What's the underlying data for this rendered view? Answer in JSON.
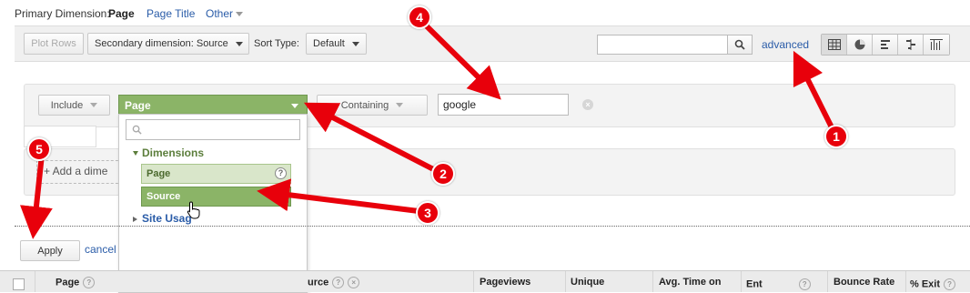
{
  "primary_dimension": {
    "label": "Primary Dimension:",
    "options": [
      {
        "label": "Page",
        "selected": true
      },
      {
        "label": "Page Title",
        "selected": false
      },
      {
        "label": "Other",
        "selected": false
      }
    ]
  },
  "toolbar": {
    "plot_rows": "Plot Rows",
    "secondary_dimension": "Secondary dimension: Source",
    "sort_type_label": "Sort Type:",
    "sort_type_value": "Default",
    "search_value": "",
    "advanced_link": "advanced",
    "view_icons": [
      "table-view-icon",
      "pie-view-icon",
      "performance-view-icon",
      "comparison-view-icon",
      "term-cloud-view-icon"
    ]
  },
  "filter": {
    "include_select": "Include",
    "dimension_select": "Page",
    "match_select": "Containing",
    "value": "google",
    "add_dimension": "+ Add a dime"
  },
  "dropdown": {
    "search_placeholder": "",
    "section_dimensions": "Dimensions",
    "items": [
      "Page",
      "Source"
    ],
    "section_site_usage": "Site Usag"
  },
  "actions": {
    "apply": "Apply",
    "cancel": "cancel"
  },
  "table_header": {
    "col_page": "Page",
    "col_source": "urce",
    "col_pageviews": "Pageviews",
    "col_unique": "Unique",
    "col_avg_time": "Avg. Time on",
    "col_entrances": "Ent",
    "col_bounce": "Bounce Rate",
    "col_exit": "% Exit"
  },
  "annotations": [
    "1",
    "2",
    "3",
    "4",
    "5"
  ],
  "colors": {
    "link": "#2a5ca8",
    "green": "#8bb467",
    "arrow": "#e8000b"
  }
}
